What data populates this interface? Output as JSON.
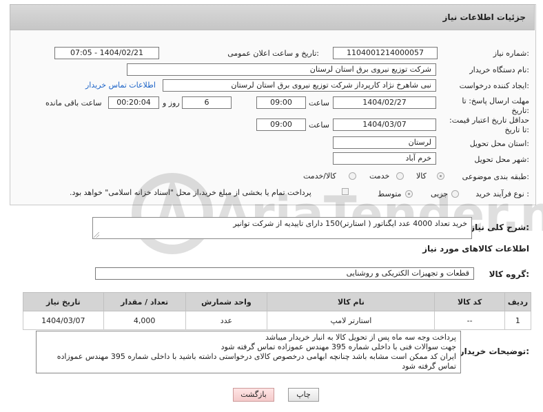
{
  "header": {
    "title": "جزئیات اطلاعات نیاز"
  },
  "fields": {
    "need_number": {
      "label": "شماره نیاز:",
      "value": "1104001214000057"
    },
    "announce_datetime": {
      "label": "تاریخ و ساعت اعلان عمومی:",
      "value": "1404/02/21 - 07:05"
    },
    "buyer_org": {
      "label": "نام دستگاه خریدار:",
      "value": "شرکت توزیع نیروی برق استان لرستان"
    },
    "requester": {
      "label": "ایجاد کننده درخواست:",
      "value": "نبی شاهرخ نژاد کارپرداز شرکت توزیع نیروی برق استان لرستان",
      "contact_link": "اطلاعات تماس خریدار"
    },
    "reply_deadline": {
      "label": "مهلت ارسال پاسخ: تا تاریخ:",
      "date": "1404/02/27",
      "time_label": "ساعت",
      "time": "09:00",
      "days": "6",
      "days_label": "روز و",
      "remaining": "00:20:04",
      "remaining_label": "ساعت باقی مانده"
    },
    "price_validity": {
      "label": "حداقل تاریخ اعتبار قیمت: تا تاریخ:",
      "date": "1404/03/07",
      "time_label": "ساعت",
      "time": "09:00"
    },
    "province": {
      "label": "استان محل تحویل:",
      "value": "لرستان"
    },
    "city": {
      "label": "شهر محل تحویل:",
      "value": "خرم آباد"
    },
    "category": {
      "label": "طبقه بندی موضوعی:",
      "options": [
        "کالا",
        "خدمت",
        "کالا/خدمت"
      ],
      "selected": "کالا"
    },
    "purchase_type": {
      "label": "نوع فرآیند خرید :",
      "options": [
        "جزیی",
        "متوسط"
      ],
      "selected": "متوسط",
      "payment_note": "پرداخت تمام یا بخشی از مبلغ خرید،از محل \"اسناد خزانه اسلامی\" خواهد بود."
    }
  },
  "description": {
    "label": "شرح کلی نیاز:",
    "value": "خرید تعداد 4000 عدد ایگناتور ( استارتر)150 دارای تاییدیه از شرکت توانیر"
  },
  "goods_section": {
    "title": "اطلاعات کالاهای مورد نیاز",
    "group_label": "گروه کالا:",
    "group_value": "قطعات و تجهیزات الکتریکی و روشنایی"
  },
  "goods_table": {
    "headers": [
      "ردیف",
      "کد کالا",
      "نام کالا",
      "واحد شمارش",
      "تعداد / مقدار",
      "تاریخ نیاز"
    ],
    "rows": [
      [
        "1",
        "--",
        "استارتر لامپ",
        "عدد",
        "4,000",
        "1404/03/07"
      ]
    ]
  },
  "buyer_notes": {
    "label": "توضیحات خریدار:",
    "lines": [
      "پرداخت وجه سه ماه پس از تحویل کالا  به انبار خریدار میباشد",
      "جهت سوالات فنی با داخلی شماره 395 مهندس عموزاده تماس گرفته شود",
      "ایران کد ممکن است مشابه باشد چنانچه ابهامی درخصوص کالای درخواستی داشته باشید با داخلی شماره 395 مهندس عموزاده تماس گرفته شود"
    ]
  },
  "buttons": {
    "print": "چاپ",
    "back": "بازگشت"
  },
  "watermark": {
    "text": "AriaTender.neT"
  },
  "colors": {
    "link": "#1a62c7",
    "header_bg": "#cfcfcf",
    "back_button": "#f4caca"
  }
}
